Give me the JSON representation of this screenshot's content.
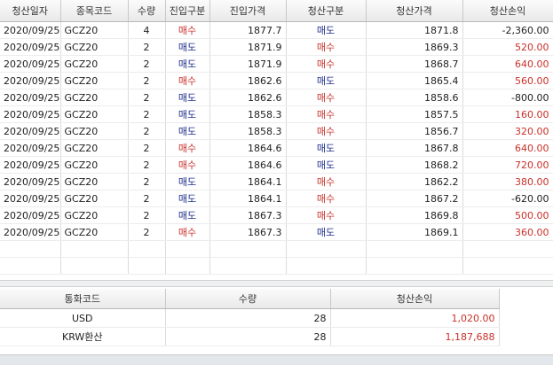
{
  "grid": {
    "headers": [
      "청산일자",
      "종목코드",
      "수량",
      "진입구분",
      "진입가격",
      "청산구분",
      "청산가격",
      "청산손익"
    ],
    "rows": [
      {
        "date": "2020/09/25",
        "code": "GCZ20",
        "qty": "4",
        "entry_side": "매수",
        "entry_price": "1877.7",
        "close_side": "매도",
        "close_price": "1871.8",
        "pnl": "-2,360.00"
      },
      {
        "date": "2020/09/25",
        "code": "GCZ20",
        "qty": "2",
        "entry_side": "매도",
        "entry_price": "1871.9",
        "close_side": "매수",
        "close_price": "1869.3",
        "pnl": "520.00"
      },
      {
        "date": "2020/09/25",
        "code": "GCZ20",
        "qty": "2",
        "entry_side": "매도",
        "entry_price": "1871.9",
        "close_side": "매수",
        "close_price": "1868.7",
        "pnl": "640.00"
      },
      {
        "date": "2020/09/25",
        "code": "GCZ20",
        "qty": "2",
        "entry_side": "매수",
        "entry_price": "1862.6",
        "close_side": "매도",
        "close_price": "1865.4",
        "pnl": "560.00"
      },
      {
        "date": "2020/09/25",
        "code": "GCZ20",
        "qty": "2",
        "entry_side": "매도",
        "entry_price": "1862.6",
        "close_side": "매수",
        "close_price": "1858.6",
        "pnl": "-800.00"
      },
      {
        "date": "2020/09/25",
        "code": "GCZ20",
        "qty": "2",
        "entry_side": "매도",
        "entry_price": "1858.3",
        "close_side": "매수",
        "close_price": "1857.5",
        "pnl": "160.00"
      },
      {
        "date": "2020/09/25",
        "code": "GCZ20",
        "qty": "2",
        "entry_side": "매도",
        "entry_price": "1858.3",
        "close_side": "매수",
        "close_price": "1856.7",
        "pnl": "320.00"
      },
      {
        "date": "2020/09/25",
        "code": "GCZ20",
        "qty": "2",
        "entry_side": "매수",
        "entry_price": "1864.6",
        "close_side": "매도",
        "close_price": "1867.8",
        "pnl": "640.00"
      },
      {
        "date": "2020/09/25",
        "code": "GCZ20",
        "qty": "2",
        "entry_side": "매수",
        "entry_price": "1864.6",
        "close_side": "매도",
        "close_price": "1868.2",
        "pnl": "720.00"
      },
      {
        "date": "2020/09/25",
        "code": "GCZ20",
        "qty": "2",
        "entry_side": "매도",
        "entry_price": "1864.1",
        "close_side": "매수",
        "close_price": "1862.2",
        "pnl": "380.00"
      },
      {
        "date": "2020/09/25",
        "code": "GCZ20",
        "qty": "2",
        "entry_side": "매도",
        "entry_price": "1864.1",
        "close_side": "매수",
        "close_price": "1867.2",
        "pnl": "-620.00"
      },
      {
        "date": "2020/09/25",
        "code": "GCZ20",
        "qty": "2",
        "entry_side": "매도",
        "entry_price": "1867.3",
        "close_side": "매수",
        "close_price": "1869.8",
        "pnl": "500.00"
      },
      {
        "date": "2020/09/25",
        "code": "GCZ20",
        "qty": "2",
        "entry_side": "매수",
        "entry_price": "1867.3",
        "close_side": "매도",
        "close_price": "1869.1",
        "pnl": "360.00"
      }
    ]
  },
  "summary": {
    "headers": [
      "통화코드",
      "수량",
      "청산손익"
    ],
    "rows": [
      {
        "currency": "USD",
        "qty": "28",
        "pnl": "1,020.00"
      },
      {
        "currency": "KRW환산",
        "qty": "28",
        "pnl": "1,187,688"
      }
    ]
  },
  "colors": {
    "buy": "#c8312a",
    "sell": "#1f2f8c",
    "profit": "#c8312a"
  }
}
